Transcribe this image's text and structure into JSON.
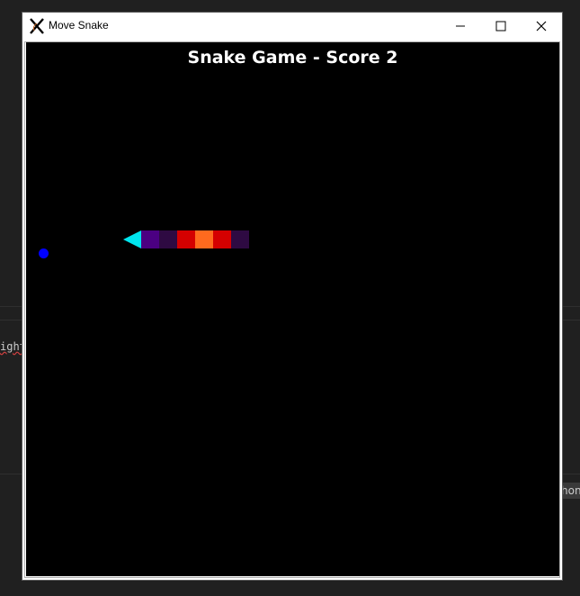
{
  "window": {
    "title": "Move Snake",
    "icon": "x-app-icon"
  },
  "controls": {
    "minimize_icon": "minimize-icon",
    "maximize_icon": "maximize-icon",
    "close_icon": "close-icon"
  },
  "game": {
    "title": "Snake Game - Score 2",
    "score": 2,
    "background": "#000000",
    "food_color": "#0000ff",
    "head_color": "#00e5ee",
    "head_direction": "left",
    "body_colors": [
      "#4b0082",
      "#2e0a42",
      "#d40000",
      "#ff6a1e",
      "#d40000",
      "#2e0a42"
    ]
  },
  "background_app": {
    "left_text": "ight",
    "right_text": "hon"
  }
}
